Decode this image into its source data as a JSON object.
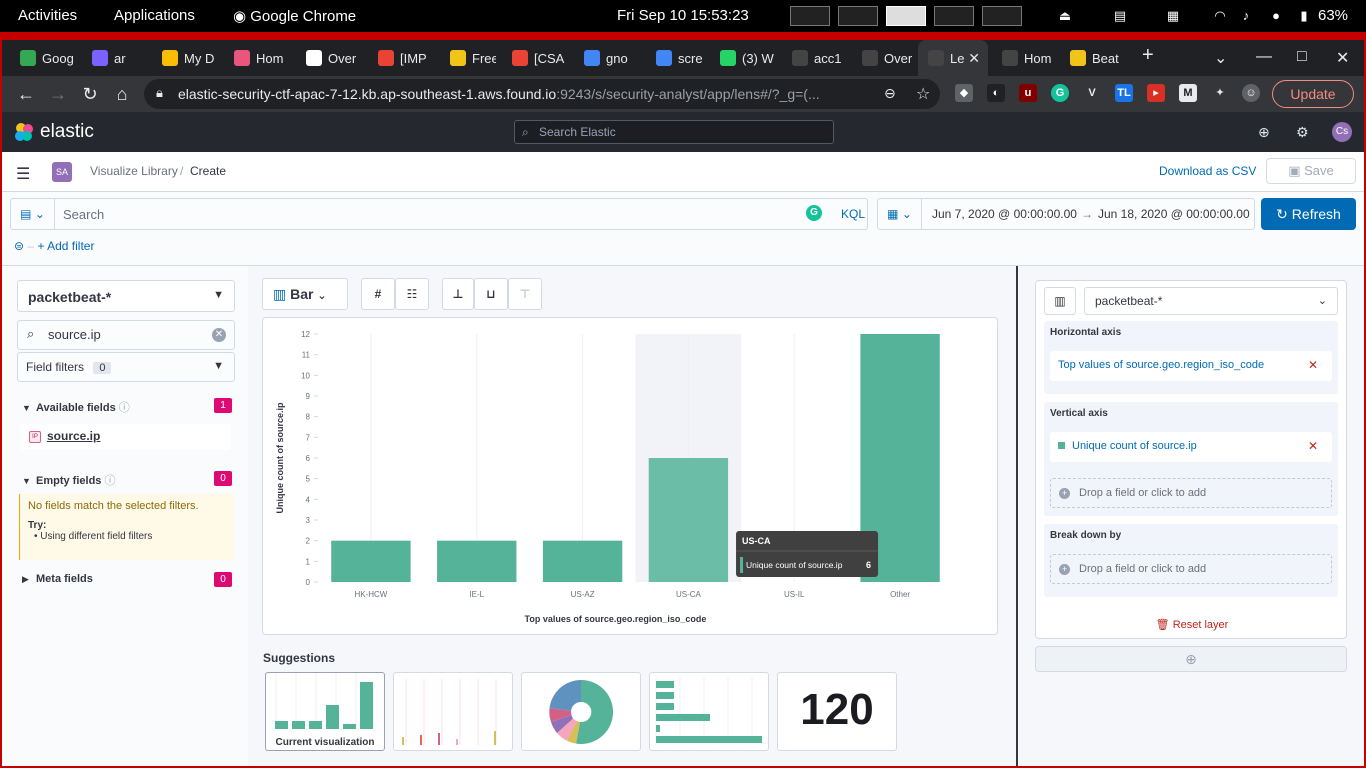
{
  "os": {
    "activities": "Activities",
    "applications": "Applications",
    "app_name": "Google Chrome",
    "clock": "Fri Sep 10  15:53:23",
    "battery": "63%"
  },
  "browser": {
    "tabs": [
      {
        "label": "Goog",
        "color": "#34a853"
      },
      {
        "label": "ar",
        "color": "#7b61ff"
      },
      {
        "label": "My D",
        "color": "#fbbc04"
      },
      {
        "label": "Hom",
        "color": "#e8567c"
      },
      {
        "label": "Over",
        "color": "#ffffff"
      },
      {
        "label": "[IMP",
        "color": "#ea4335"
      },
      {
        "label": "Free",
        "color": "#f0c419"
      },
      {
        "label": "[CSA",
        "color": "#ea4335"
      },
      {
        "label": "gno",
        "color": "#4285f4"
      },
      {
        "label": "scre",
        "color": "#4285f4"
      },
      {
        "label": "(3) W",
        "color": "#25d366"
      },
      {
        "label": "acc1",
        "color": "#444444"
      },
      {
        "label": "Over",
        "color": "#444444"
      },
      {
        "label": "Le",
        "color": "#444444"
      },
      {
        "label": "Hom",
        "color": "#444444"
      },
      {
        "label": "Beat",
        "color": "#f0c419"
      }
    ],
    "url_main": "elastic-security-ctf-apac-7-12.kb.ap-southeast-1.aws.found.io",
    "url_rest": ":9243/s/security-analyst/app/lens#/?_g=(...",
    "update_label": "Update"
  },
  "kibana": {
    "brand": "elastic",
    "search_placeholder": "Search Elastic",
    "avatar": "Cs",
    "space_badge": "SA",
    "breadcrumbs": [
      "Visualize Library",
      "Create"
    ],
    "download_csv": "Download as CSV",
    "save": "Save",
    "query_placeholder": "Search",
    "kql": "KQL",
    "date_start": "Jun 7, 2020 @ 00:00:00.00",
    "date_end": "Jun 18, 2020 @ 00:00:00.00",
    "refresh": "Refresh",
    "add_filter": "+ Add filter"
  },
  "field_list": {
    "index_pattern": "packetbeat-*",
    "search_value": "source.ip",
    "field_filters_label": "Field filters",
    "field_filters_count": "0",
    "available_label": "Available fields",
    "available_count": "1",
    "available_field": "source.ip",
    "empty_label": "Empty fields",
    "empty_count": "0",
    "empty_message": "No fields match the selected filters.",
    "try_label": "Try:",
    "try_item": "Using different field filters",
    "meta_label": "Meta fields",
    "meta_count": "0"
  },
  "workspace": {
    "chart_type_label": "Bar",
    "suggestions_title": "Suggestions",
    "suggestion_current_label": "Current visualization",
    "suggestion_metric_value": "120",
    "tooltip": {
      "title": "US-CA",
      "label": "Unique count of source.ip",
      "value": "6"
    }
  },
  "config": {
    "index_pattern": "packetbeat-*",
    "horizontal_axis_title": "Horizontal axis",
    "horizontal_axis_value": "Top values of source.geo.region_iso_code",
    "vertical_axis_title": "Vertical axis",
    "vertical_axis_value": "Unique count of source.ip",
    "drop_label": "Drop a field or click to add",
    "breakdown_title": "Break down by",
    "reset_layer": "Reset layer"
  },
  "chart_data": {
    "type": "bar",
    "categories": [
      "HK-HCW",
      "IE-L",
      "US-AZ",
      "US-CA",
      "US-IL",
      "Other"
    ],
    "values": [
      2,
      2,
      2,
      6,
      0,
      12
    ],
    "xlabel": "Top values of source.geo.region_iso_code",
    "ylabel": "Unique count of source.ip",
    "ylim": [
      0,
      12
    ],
    "yticks": [
      0,
      1,
      2,
      3,
      4,
      5,
      6,
      7,
      8,
      9,
      10,
      11,
      12
    ],
    "bar_color": "#54b399",
    "highlight_category": "US-CA",
    "grid": true
  }
}
